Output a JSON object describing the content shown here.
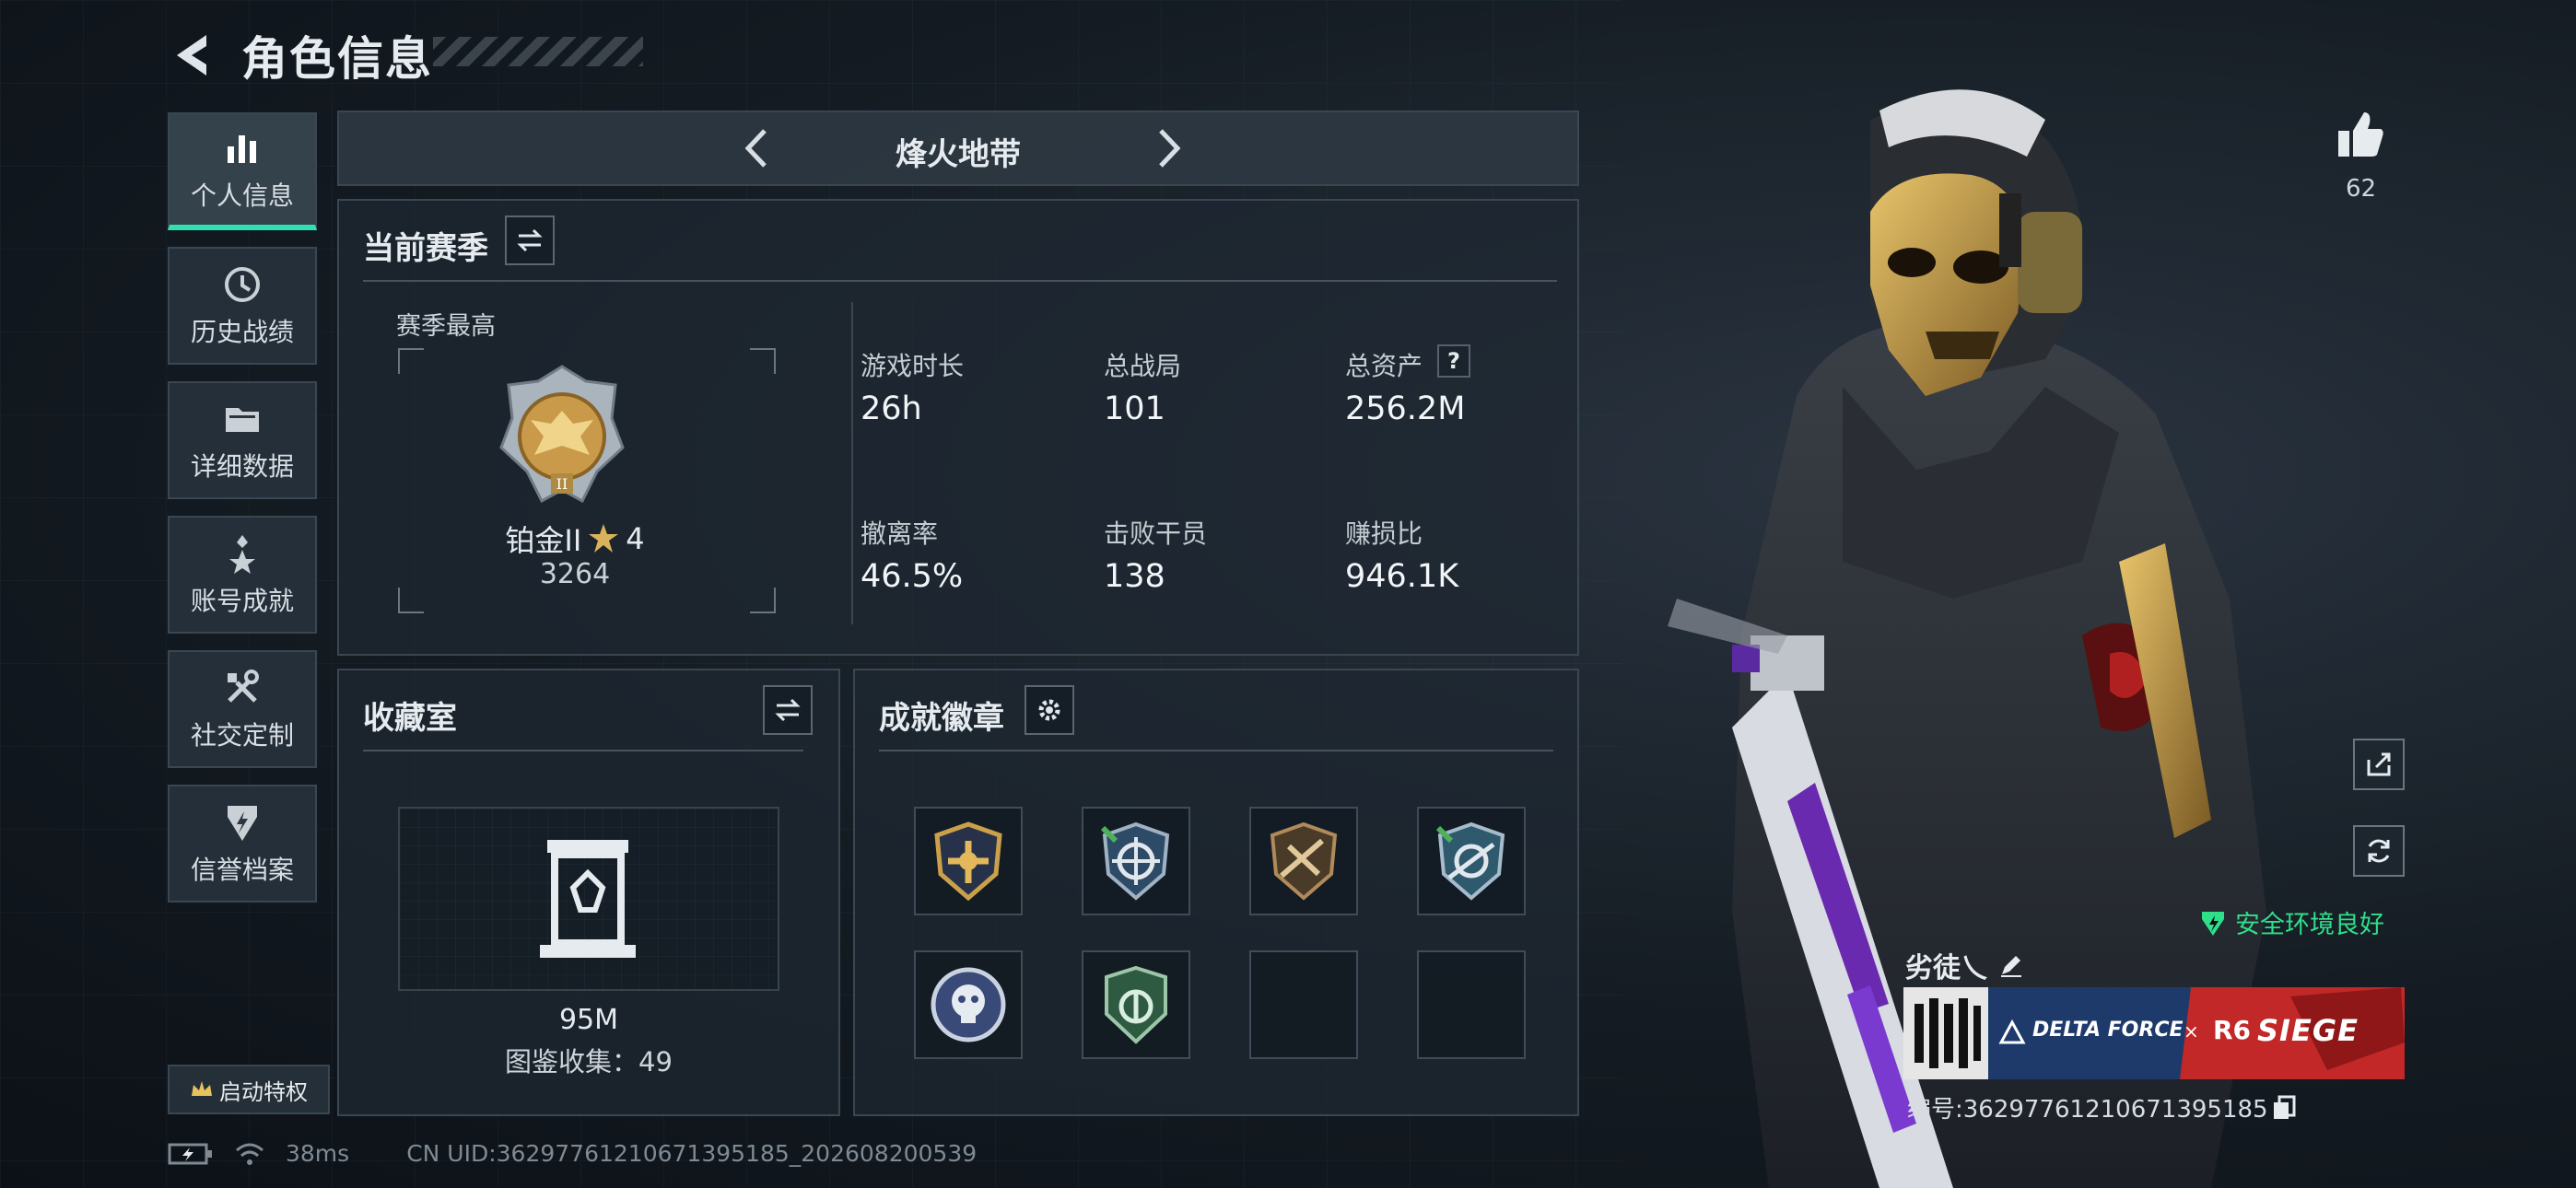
{
  "header": {
    "title": "角色信息",
    "back_icon": "back-arrow-icon"
  },
  "sidebar": {
    "items": [
      {
        "label": "个人信息",
        "icon": "bar-chart-icon",
        "active": true
      },
      {
        "label": "历史战绩",
        "icon": "clock-icon",
        "active": false
      },
      {
        "label": "详细数据",
        "icon": "folder-icon",
        "active": false
      },
      {
        "label": "账号成就",
        "icon": "star-badge-icon",
        "active": false
      },
      {
        "label": "社交定制",
        "icon": "tools-icon",
        "active": false
      },
      {
        "label": "信誉档案",
        "icon": "shield-icon",
        "active": false
      }
    ],
    "privilege_label": "启动特权"
  },
  "mode": {
    "name": "烽火地带"
  },
  "season": {
    "title": "当前赛季",
    "peak_label": "赛季最高",
    "rank_name": "铂金II",
    "stars": "4",
    "score": "3264",
    "stats": [
      {
        "label": "游戏时长",
        "value": "26h"
      },
      {
        "label": "总战局",
        "value": "101"
      },
      {
        "label": "总资产",
        "value": "256.2M",
        "help": "?"
      },
      {
        "label": "撤离率",
        "value": "46.5%"
      },
      {
        "label": "击败干员",
        "value": "138"
      },
      {
        "label": "赚损比",
        "value": "946.1K"
      }
    ]
  },
  "collection": {
    "title": "收藏室",
    "value": "95M",
    "count_text": "图鉴收集：49"
  },
  "badges": {
    "title": "成就徽章",
    "slots": [
      {
        "icon": "gold-crossbow-badge-icon",
        "filled": true
      },
      {
        "icon": "blue-crosshair-badge-icon",
        "filled": true
      },
      {
        "icon": "bronze-rifle-badge-icon",
        "filled": true
      },
      {
        "icon": "blue-rifle-badge-icon",
        "filled": true
      },
      {
        "icon": "silver-skull-badge-icon",
        "filled": true
      },
      {
        "icon": "green-shield-badge-icon",
        "filled": true
      },
      {
        "icon": "",
        "filled": false
      },
      {
        "icon": "",
        "filled": false
      }
    ]
  },
  "profile": {
    "likes": "62",
    "security_text": "安全环境良好",
    "player_name": "劣徒乀",
    "banner_left": "DELTA FORCE",
    "banner_x": "×",
    "banner_right_a": "R6",
    "banner_right_b": "SIEGE",
    "player_id": "编号:3629776121067139518​5"
  },
  "footer": {
    "ping": "38ms",
    "uid_text": "CN UID:36297761210671395185_202608200539"
  },
  "colors": {
    "accent": "#2fe0b0",
    "security": "#2fe08a",
    "gold": "#c9a24a"
  }
}
